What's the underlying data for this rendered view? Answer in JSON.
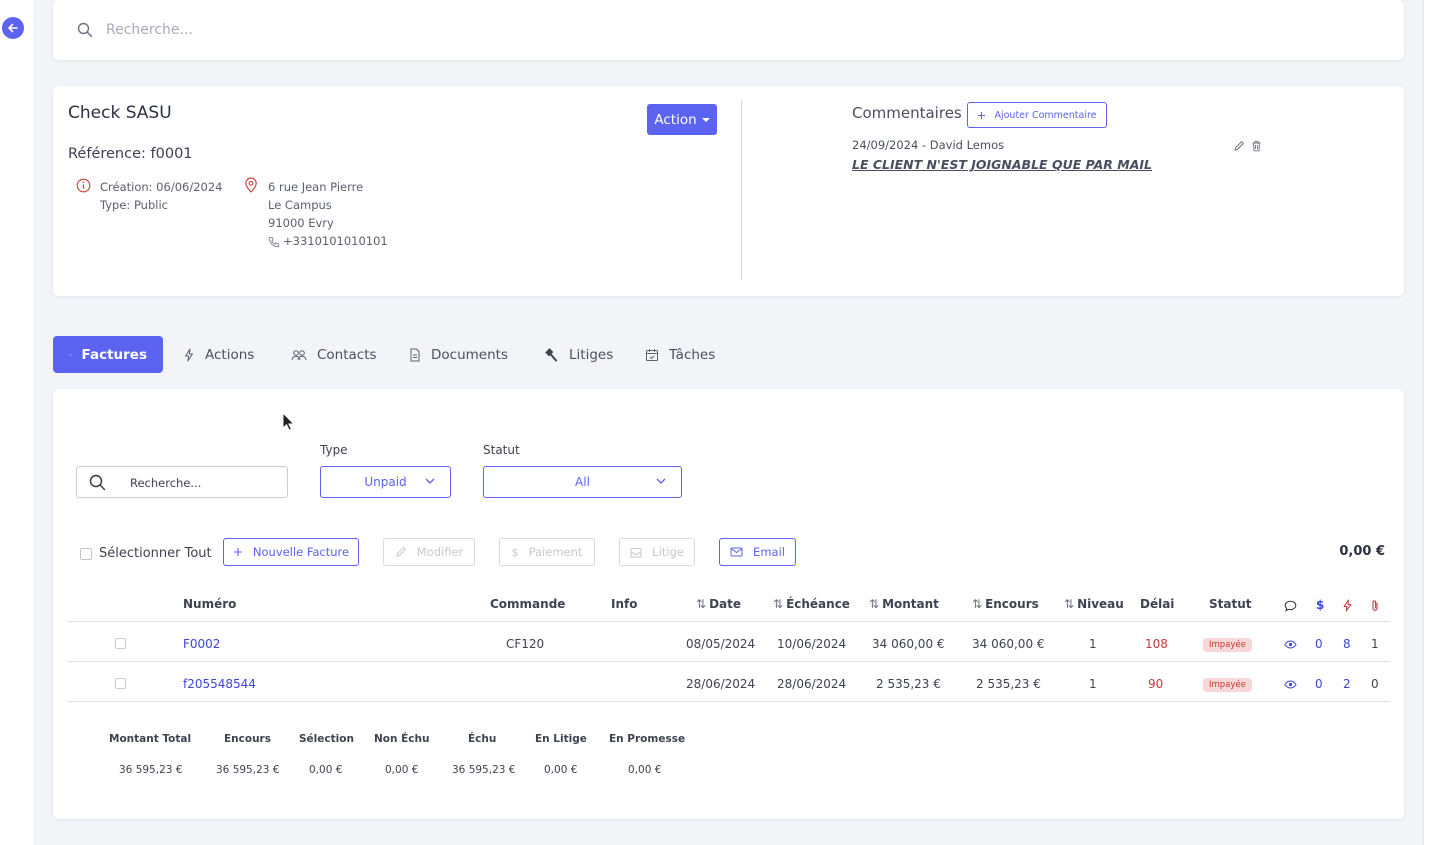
{
  "search": {
    "placeholder": "Recherche..."
  },
  "company": {
    "name": "Check SASU",
    "reference": "Référence: f0001",
    "creation": "Création: 06/06/2024",
    "type": "Type: Public",
    "address1": "6 rue Jean Pierre",
    "address2": "Le Campus",
    "address3": "91000 Evry",
    "phone": "+3310101010101",
    "action_label": "Action"
  },
  "comments": {
    "title": "Commentaires",
    "add_label": "Ajouter Commentaire",
    "items": [
      {
        "meta": "24/09/2024 - David Lemos",
        "text": "LE CLIENT N'EST JOIGNABLE QUE PAR MAIL"
      }
    ]
  },
  "tabs": [
    {
      "label": "Factures",
      "icon": "list-icon",
      "active": true
    },
    {
      "label": "Actions",
      "icon": "bolt-icon"
    },
    {
      "label": "Contacts",
      "icon": "users-icon"
    },
    {
      "label": "Documents",
      "icon": "document-icon"
    },
    {
      "label": "Litiges",
      "icon": "hammer-icon"
    },
    {
      "label": "Tâches",
      "icon": "calendar-icon"
    }
  ],
  "filters": {
    "search_value": "Recherche...",
    "type_label": "Type",
    "type_value": "Unpaid",
    "status_label": "Statut",
    "status_value": "All"
  },
  "toolbar": {
    "select_all": "Sélectionner Tout",
    "new_invoice": "Nouvelle Facture",
    "modify": "Modifier",
    "payment": "Paiement",
    "dispute": "Litige",
    "email": "Email",
    "total": "0,00 €"
  },
  "table": {
    "headers": {
      "numero": "Numéro",
      "commande": "Commande",
      "info": "Info",
      "date": "Date",
      "echeance": "Échéance",
      "montant": "Montant",
      "encours": "Encours",
      "niveau": "Niveau",
      "delai": "Délai",
      "statut": "Statut"
    },
    "rows": [
      {
        "numero": "F0002",
        "commande": "CF120",
        "date": "08/05/2024",
        "echeance": "10/06/2024",
        "montant": "34 060,00 €",
        "encours": "34 060,00 €",
        "niveau": "1",
        "delai": "108",
        "statut": "Impayée",
        "comments": "0",
        "actions": "8",
        "attachments": "1"
      },
      {
        "numero": "f205548544",
        "commande": "",
        "date": "28/06/2024",
        "echeance": "28/06/2024",
        "montant": "2 535,23 €",
        "encours": "2 535,23 €",
        "niveau": "1",
        "delai": "90",
        "statut": "Impayée",
        "comments": "0",
        "actions": "2",
        "attachments": "0"
      }
    ]
  },
  "summary": {
    "headers": [
      "Montant Total",
      "Encours",
      "Sélection",
      "Non Échu",
      "Échu",
      "En Litige",
      "En Promesse"
    ],
    "values": [
      "36 595,23 €",
      "36 595,23 €",
      "0,00 €",
      "0,00 €",
      "36 595,23 €",
      "0,00 €",
      "0,00 €"
    ]
  },
  "colors": {
    "accent": "#5b63f0",
    "danger": "#c53a3a",
    "badge_bg": "#f8d7da"
  }
}
